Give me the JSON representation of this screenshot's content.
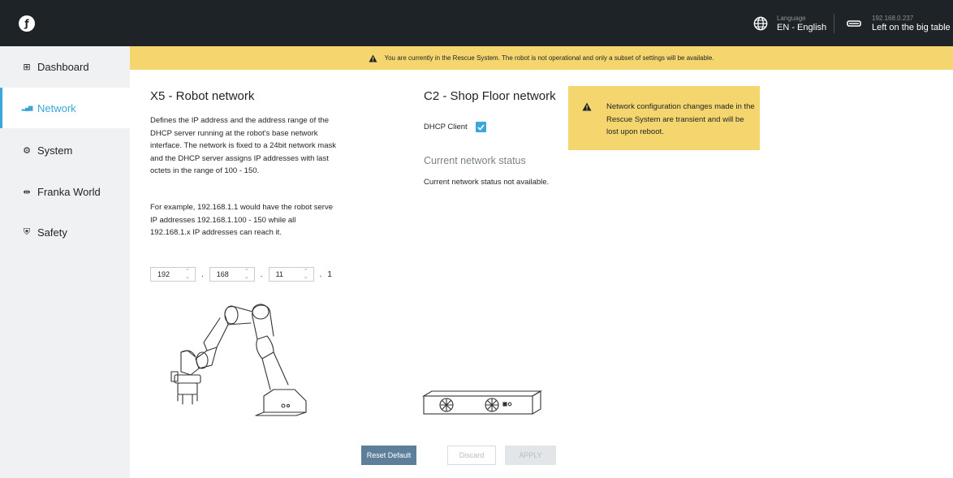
{
  "header": {
    "logo_glyph": "ƒ",
    "language": {
      "label": "Language",
      "value": "EN - English"
    },
    "robot": {
      "ip": "192.168.0.237",
      "location": "Left on the big table"
    }
  },
  "sidebar": {
    "items": [
      {
        "label": "Dashboard",
        "icon": "dashboard-icon",
        "glyph": "⊞"
      },
      {
        "label": "Network",
        "icon": "network-bars-icon",
        "glyph": "▂▄▆"
      },
      {
        "label": "System",
        "icon": "gear-icon",
        "glyph": "⚙"
      },
      {
        "label": "Franka World",
        "icon": "handshake-icon",
        "glyph": "⇹"
      },
      {
        "label": "Safety",
        "icon": "shield-icon",
        "glyph": "⛨"
      }
    ],
    "active_index": 1
  },
  "banner": {
    "text": "You are currently in the Rescue System. The robot is not operational and only a subset of settings will be available."
  },
  "robot_network": {
    "title": "X5 - Robot network",
    "description": "Defines the IP address and the address range of the DHCP server running at the robot's base network interface. The network is fixed to a 24bit network mask and the DHCP server assigns IP addresses with last octets in the range of 100 - 150.",
    "example": "For example, 192.168.1.1 would have the robot serve IP addresses 192.168.1.100 - 150 while all 192.168.1.x IP addresses can reach it.",
    "ip_octets": [
      "192",
      "168",
      "11"
    ],
    "ip_last": "1"
  },
  "shop_floor": {
    "title": "C2 - Shop Floor network",
    "dhcp_label": "DHCP Client",
    "dhcp_checked": true,
    "status_heading": "Current network status",
    "status_text": "Current network status not available."
  },
  "note": {
    "text": "Network configuration changes made in the Rescue System are transient and will be lost upon reboot."
  },
  "buttons": {
    "reset": "Reset Default",
    "discard": "Discard",
    "apply": "APPLY"
  },
  "colors": {
    "topbar": "#1d2326",
    "accent": "#3aa6d9",
    "warning": "#f5d66e",
    "reset_button": "#5e7f99"
  }
}
